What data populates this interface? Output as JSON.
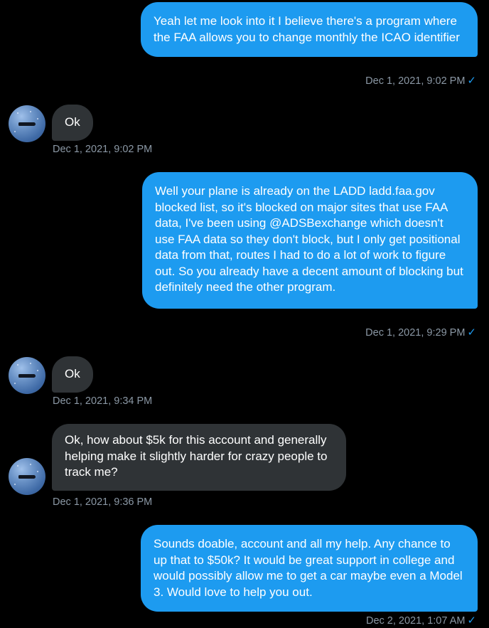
{
  "messages": [
    {
      "direction": "outgoing",
      "text": "Yeah let me look into it I believe there's a program where the FAA allows you to change monthly the ICAO identifier",
      "timestamp": "Dec 1, 2021, 9:02 PM",
      "read_indicator": "✓"
    },
    {
      "direction": "incoming",
      "text": "Ok",
      "timestamp": "Dec 1, 2021, 9:02 PM"
    },
    {
      "direction": "outgoing",
      "text": "Well your plane is already on the LADD ladd.faa.gov blocked list, so it's blocked on major sites that use FAA data, I've been using @ADSBexchange which doesn't use FAA data so they don't block, but I only get positional data from that, routes I had to do a lot of work to figure out. So you already have a decent amount of blocking but definitely need the other program.",
      "timestamp": "Dec 1, 2021, 9:29 PM",
      "read_indicator": "✓"
    },
    {
      "direction": "incoming",
      "text": "Ok",
      "timestamp": "Dec 1, 2021, 9:34 PM"
    },
    {
      "direction": "incoming",
      "text": "Ok, how about $5k for this account and generally helping make it slightly harder for crazy people to track me?",
      "timestamp": "Dec 1, 2021, 9:36 PM"
    },
    {
      "direction": "outgoing",
      "text": "Sounds doable, account and all my help. Any chance to up that to $50k? It would be great support in college and would possibly allow me to get a car maybe even a Model 3. Would love to help you out.",
      "timestamp": "Dec 2, 2021, 1:07 AM",
      "read_indicator": "✓"
    }
  ],
  "colors": {
    "background": "#000000",
    "outgoing_bubble": "#1d9bf0",
    "incoming_bubble": "#2f3336",
    "timestamp": "#8b98a5",
    "read_check": "#1d9bf0"
  },
  "icons": {
    "avatar": "avatar",
    "read_indicator": "checkmark-icon"
  }
}
